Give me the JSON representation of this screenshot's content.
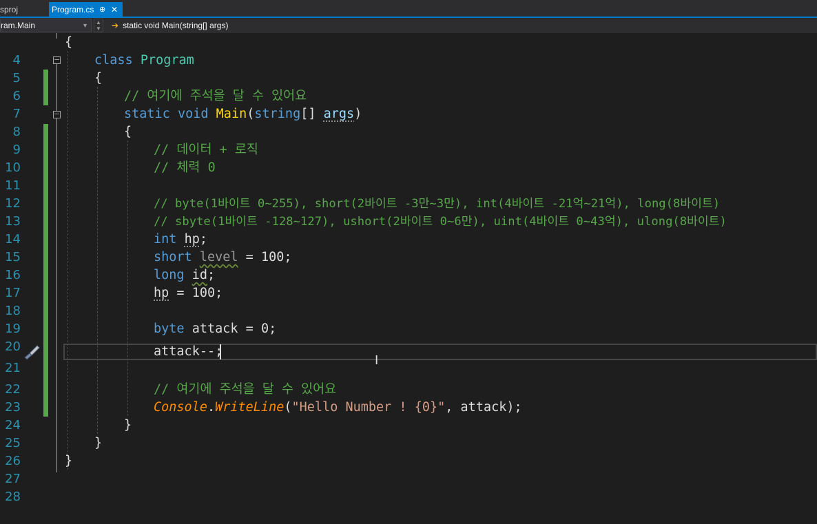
{
  "tabs": {
    "inactive_label": "sproj",
    "active_label": "Program.cs",
    "pin_glyph": "⊕",
    "close_glyph": "✕"
  },
  "navbar": {
    "left_scope": "ram.Main",
    "right_member": "static void Main(string[] args)"
  },
  "editor": {
    "current_line": 21,
    "line_numbers": [
      "4",
      "5",
      "6",
      "7",
      "8",
      "9",
      "10",
      "11",
      "12",
      "13",
      "14",
      "15",
      "16",
      "17",
      "18",
      "19",
      "20",
      "21",
      "22",
      "23",
      "24",
      "25",
      "26",
      "27",
      "28"
    ],
    "code": {
      "l4_brace": "{",
      "l5_kw": "class",
      "l5_name": "Program",
      "l6_brace": "{",
      "l7_comment": "// 여기에 주석을 달 수 있어요",
      "l8_static": "static",
      "l8_void": "void",
      "l8_main": "Main",
      "l8_open": "(",
      "l8_string": "string",
      "l8_arr": "[] ",
      "l8_args": "args",
      "l8_close": ")",
      "l9_brace": "{",
      "l10_comment": "// 데이터 + 로직",
      "l11_comment": "// 체력 0",
      "l13_comment": "// byte(1바이트 0~255), short(2바이트 -3만~3만), int(4바이트 -21억~21억), long(8바이트)",
      "l14_comment": "// sbyte(1바이트 -128~127), ushort(2바이트 0~6만), uint(4바이트 0~43억), ulong(8바이트)",
      "l15_kw": "int",
      "l15_var": "hp",
      "l15_end": ";",
      "l16_kw": "short",
      "l16_var": "level",
      "l16_rest": " = 100;",
      "l17_kw": "long",
      "l17_var": "id",
      "l17_end": ";",
      "l18_var": "hp",
      "l18_rest": " = 100;",
      "l20_kw": "byte",
      "l20_rest": " attack = 0;",
      "l21_code": "attack--;",
      "l23_comment": "// 여기에 주석을 달 수 있어요",
      "l24_console": "Console",
      "l24_dot": ".",
      "l24_method": "WriteLine",
      "l24_open": "(",
      "l24_string": "\"Hello Number ! {0}\"",
      "l24_rest": ", attack);",
      "l25_brace": "}",
      "l26_brace": "}",
      "l27_brace": "}"
    }
  },
  "icons": [
    "pin-icon",
    "close-icon",
    "dropdown-icon",
    "arrow-right-icon",
    "fold-collapse-icon",
    "paintbrush-icon",
    "i-beam-cursor-icon"
  ],
  "colors": {
    "accent": "#007acc",
    "background": "#1e1e1e",
    "keyword": "#569cd6",
    "type": "#4ec9b0",
    "comment": "#57a64a",
    "method": "#dcdcaa",
    "string": "#d69d85",
    "line_number": "#2b91af",
    "changed_bar": "#57a64a"
  }
}
